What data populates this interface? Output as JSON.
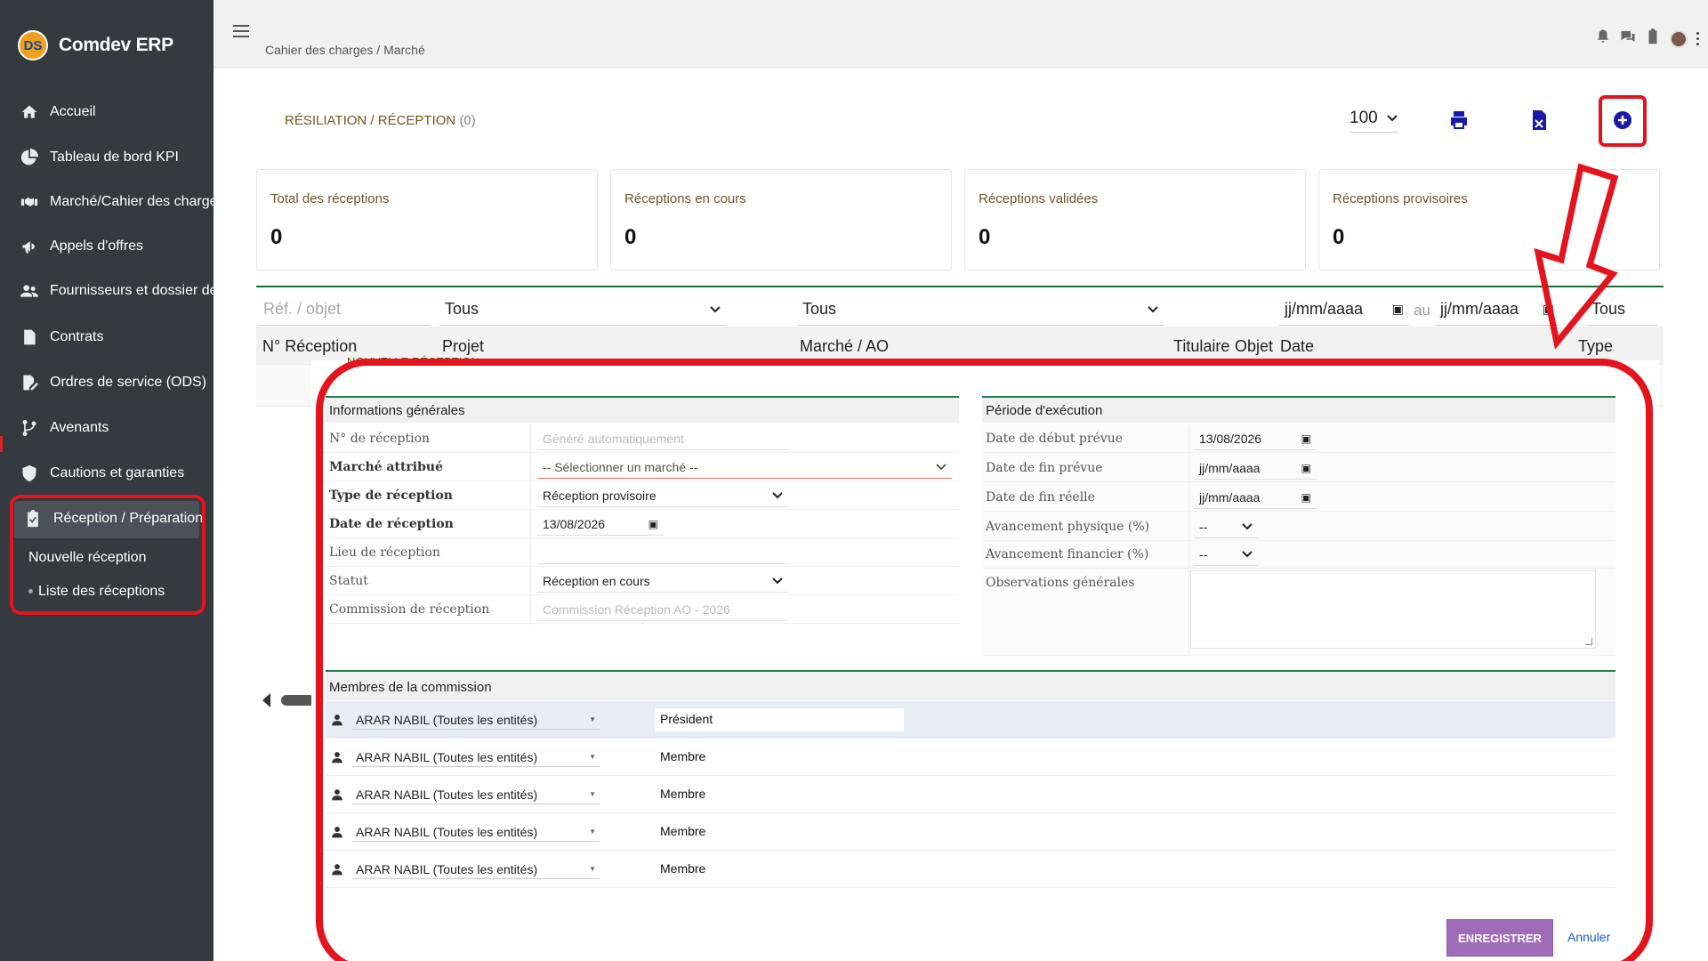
{
  "app": {
    "name": "Comdev ERP",
    "logo_text": "DS"
  },
  "sidebar": {
    "items": [
      {
        "label": "Accueil",
        "icon": "home-icon"
      },
      {
        "label": "Tableau de bord KPI",
        "icon": "pie-chart-icon"
      },
      {
        "label": "Marché/Cahier des charge",
        "icon": "handshake-icon"
      },
      {
        "label": "Appels d'offres",
        "icon": "megaphone-icon"
      },
      {
        "label": "Fournisseurs et dossier de",
        "icon": "users-icon"
      },
      {
        "label": "Contrats",
        "icon": "file-icon"
      },
      {
        "label": "Ordres de service (ODS)",
        "icon": "edit-file-icon"
      },
      {
        "label": "Avenants",
        "icon": "branch-icon"
      },
      {
        "label": "Cautions et garanties",
        "icon": "shield-icon"
      },
      {
        "label": "Réception / Préparation",
        "icon": "clipboard-check-icon"
      }
    ],
    "sub_items": [
      {
        "label": "Nouvelle réception"
      },
      {
        "label": "Liste des réceptions"
      }
    ]
  },
  "topbar": {
    "breadcrumb": "Cahier des charges / Marché"
  },
  "page": {
    "title": "RÉSILIATION / RÉCEPTION",
    "count": "(0)",
    "per_page": "100"
  },
  "stats": [
    {
      "label": "Total des réceptions",
      "value": "0"
    },
    {
      "label": "Réceptions en cours",
      "value": "0"
    },
    {
      "label": "Réceptions validées",
      "value": "0"
    },
    {
      "label": "Réceptions provisoires",
      "value": "0"
    }
  ],
  "filters": {
    "ref_placeholder": "Réf. / objet",
    "projet": "Tous",
    "marche": "Tous",
    "date_from": "jj/mm/aaaa",
    "au": "au",
    "date_to": "jj/mm/aaaa",
    "type": "Tous"
  },
  "table": {
    "headers": [
      "N° Réception",
      "Projet",
      "Marché / AO",
      "Titulaire",
      "Objet",
      "Date",
      "Type"
    ]
  },
  "modal": {
    "title": "NOUVELLE RÉCEPTION",
    "general": {
      "heading": "Informations générales",
      "fields": [
        {
          "label": "N° de réception",
          "value": "Généré automatiquement"
        },
        {
          "label": "Marché attribué",
          "value": "-- Sélectionner un marché --"
        },
        {
          "label": "Type de réception",
          "value": "Réception provisoire"
        },
        {
          "label": "Date de réception",
          "value": "13/08/2026"
        },
        {
          "label": "Lieu de réception",
          "value": ""
        },
        {
          "label": "Statut",
          "value": "Réception en cours"
        },
        {
          "label": "Commission de réception",
          "value": "Commission Réception AO - 2026"
        }
      ]
    },
    "periode": {
      "heading": "Période d'exécution",
      "fields": [
        {
          "label": "Date de début prévue",
          "value": "13/08/2026"
        },
        {
          "label": "Date de fin prévue",
          "value": "jj/mm/aaaa"
        },
        {
          "label": "Date de fin réelle",
          "value": "jj/mm/aaaa"
        },
        {
          "label": "Avancement physique (%)",
          "value": "--"
        },
        {
          "label": "Avancement financier (%)",
          "value": "--"
        },
        {
          "label": "Observations générales",
          "value": ""
        }
      ]
    },
    "commission": {
      "heading": "Membres de la commission",
      "members": [
        {
          "name": "ARAR NABIL (Toutes les entités)",
          "role": "Président"
        },
        {
          "name": "ARAR NABIL (Toutes les entités)",
          "role": "Membre"
        },
        {
          "name": "ARAR NABIL (Toutes les entités)",
          "role": "Membre"
        },
        {
          "name": "ARAR NABIL (Toutes les entités)",
          "role": "Membre"
        },
        {
          "name": "ARAR NABIL (Toutes les entités)",
          "role": "Membre"
        }
      ]
    },
    "save_label": "ENREGISTRER",
    "cancel_label": "Annuler"
  },
  "colors": {
    "sidebar": "#343a40",
    "accent_red": "#e3141e",
    "save_button": "#a06cb8",
    "link_blue": "#1a56c8",
    "icon_blue": "#1a1aa8"
  }
}
